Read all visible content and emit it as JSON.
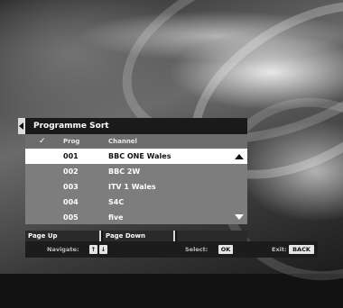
{
  "menu": {
    "title": "Programme Sort",
    "columns": {
      "check": "✓",
      "prog": "Prog",
      "channel": "Channel"
    },
    "rows": [
      {
        "num": "001",
        "name": "BBC ONE Wales",
        "selected": true
      },
      {
        "num": "002",
        "name": "BBC 2W",
        "selected": false
      },
      {
        "num": "003",
        "name": "ITV 1 Wales",
        "selected": false
      },
      {
        "num": "004",
        "name": "S4C",
        "selected": false
      },
      {
        "num": "005",
        "name": "five",
        "selected": false
      }
    ]
  },
  "function_keys": {
    "key1": "Page Up",
    "key2": "Page Down",
    "key3": ""
  },
  "help_bar": {
    "navigate_label": "Navigate:",
    "up_key": "↑",
    "down_key": "↓",
    "select_label": "Select:",
    "ok_key": "OK",
    "exit_label": "Exit:",
    "back_key": "BACK"
  }
}
